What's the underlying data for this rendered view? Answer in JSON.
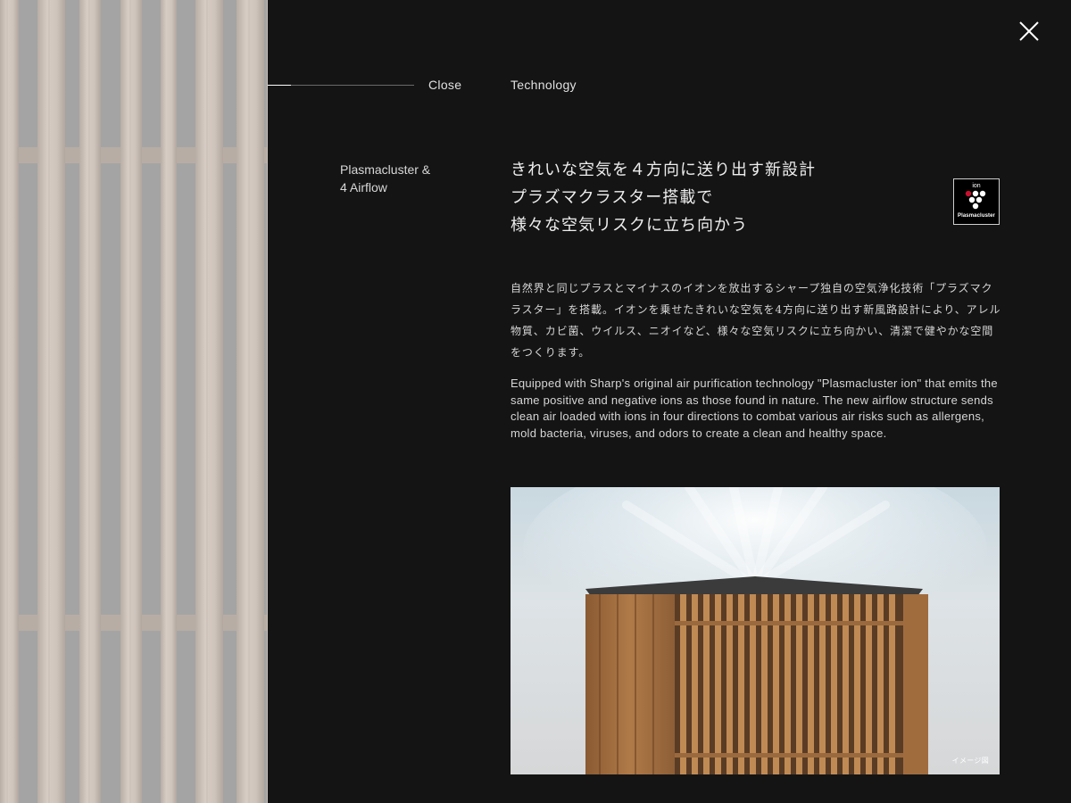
{
  "nav": {
    "close_label": "Close",
    "tech_label": "Technology"
  },
  "section": {
    "label_line1": "Plasmacluster &",
    "label_line2": "4 Airflow"
  },
  "headline": {
    "line1": "きれいな空気を４方向に送り出す新設計",
    "line2": "プラズマクラスター搭載で",
    "line3": "様々な空気リスクに立ち向かう"
  },
  "logo": {
    "ion_text": "ion",
    "brand_text": "Plasmacluster"
  },
  "body": {
    "jp": "自然界と同じプラスとマイナスのイオンを放出するシャープ独自の空気浄化技術「プラズマクラスター」を搭載。イオンを乗せたきれいな空気を4方向に送り出す新風路設計により、アレル物質、カビ菌、ウイルス、ニオイなど、様々な空気リスクに立ち向かい、清潔で健やかな空間をつくります。",
    "en": "Equipped with Sharp's original air purification technology \"Plasmacluster ion\" that emits the same positive and negative ions as those found in nature. The new airflow structure sends clean air loaded with ions in four directions to combat various air risks such as allergens, mold bacteria, viruses, and odors to create a clean and healthy space."
  },
  "image": {
    "caption": "イメージ図"
  },
  "icons": {
    "close": "close-icon",
    "logo": "plasmacluster-logo-icon"
  },
  "colors": {
    "background": "#141414",
    "text": "#e6e6e6",
    "logo_dot": "#c8102e"
  }
}
